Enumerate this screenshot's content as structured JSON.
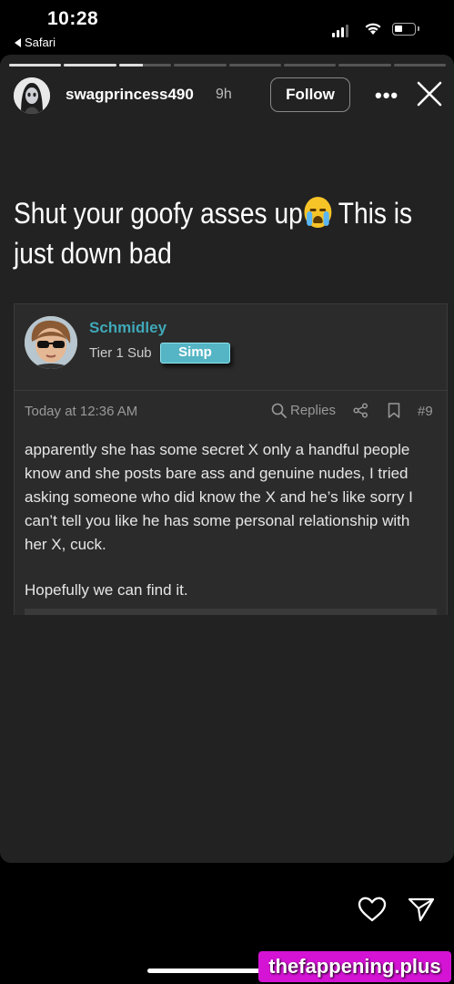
{
  "status_bar": {
    "time": "10:28",
    "back_label": "Safari",
    "signal_bars_filled": 3,
    "battery_level": 0.4
  },
  "story": {
    "progress": {
      "segments": 8,
      "completed": 2,
      "current_fill": 0.45
    },
    "username": "swagprincess490",
    "time_ago": "9h",
    "follow_label": "Follow",
    "more_label": "•••",
    "caption_before_emoji": "Shut your goofy asses up",
    "caption_after_emoji": " This is just down bad",
    "emoji_icon": "loudly-crying-face-icon"
  },
  "forum_post": {
    "author": "Schmidley",
    "tier": "Tier 1 Sub",
    "badge": "Simp",
    "date": "Today at 12:36 AM",
    "replies_label": "Replies",
    "post_number": "#9",
    "body": [
      "apparently she has some secret X only a handful people know and she posts bare ass and genuine nudes, I tried asking someone who did know the X and he’s like sorry I can’t tell you like he has some personal relationship with her X, cuck.",
      "Hopefully we can find it."
    ],
    "colors": {
      "author": "#3fa8b8",
      "badge": "#55b5c4"
    }
  },
  "actions": {
    "like_icon": "heart-icon",
    "share_icon": "send-icon"
  },
  "watermark": "thefappening.plus"
}
